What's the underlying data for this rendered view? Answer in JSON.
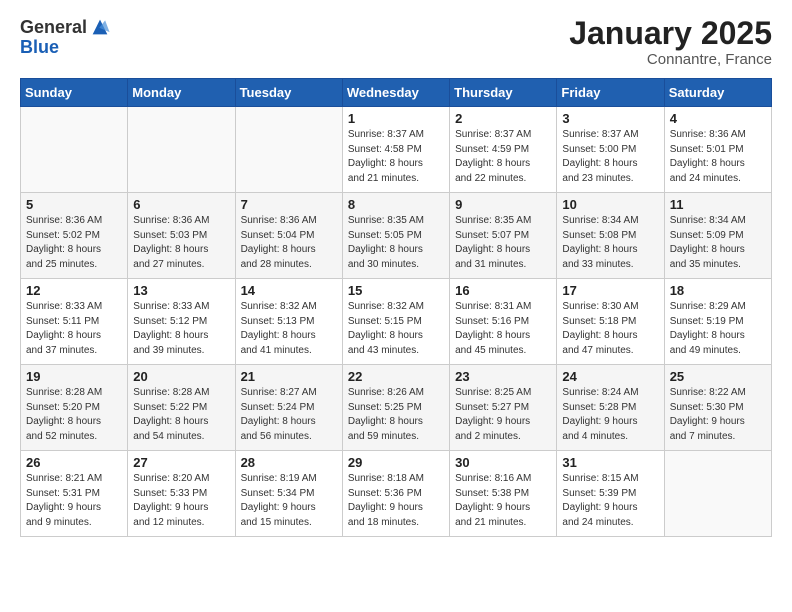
{
  "logo": {
    "general": "General",
    "blue": "Blue"
  },
  "title": "January 2025",
  "subtitle": "Connantre, France",
  "weekdays": [
    "Sunday",
    "Monday",
    "Tuesday",
    "Wednesday",
    "Thursday",
    "Friday",
    "Saturday"
  ],
  "weeks": [
    [
      {
        "day": "",
        "info": ""
      },
      {
        "day": "",
        "info": ""
      },
      {
        "day": "",
        "info": ""
      },
      {
        "day": "1",
        "info": "Sunrise: 8:37 AM\nSunset: 4:58 PM\nDaylight: 8 hours\nand 21 minutes."
      },
      {
        "day": "2",
        "info": "Sunrise: 8:37 AM\nSunset: 4:59 PM\nDaylight: 8 hours\nand 22 minutes."
      },
      {
        "day": "3",
        "info": "Sunrise: 8:37 AM\nSunset: 5:00 PM\nDaylight: 8 hours\nand 23 minutes."
      },
      {
        "day": "4",
        "info": "Sunrise: 8:36 AM\nSunset: 5:01 PM\nDaylight: 8 hours\nand 24 minutes."
      }
    ],
    [
      {
        "day": "5",
        "info": "Sunrise: 8:36 AM\nSunset: 5:02 PM\nDaylight: 8 hours\nand 25 minutes."
      },
      {
        "day": "6",
        "info": "Sunrise: 8:36 AM\nSunset: 5:03 PM\nDaylight: 8 hours\nand 27 minutes."
      },
      {
        "day": "7",
        "info": "Sunrise: 8:36 AM\nSunset: 5:04 PM\nDaylight: 8 hours\nand 28 minutes."
      },
      {
        "day": "8",
        "info": "Sunrise: 8:35 AM\nSunset: 5:05 PM\nDaylight: 8 hours\nand 30 minutes."
      },
      {
        "day": "9",
        "info": "Sunrise: 8:35 AM\nSunset: 5:07 PM\nDaylight: 8 hours\nand 31 minutes."
      },
      {
        "day": "10",
        "info": "Sunrise: 8:34 AM\nSunset: 5:08 PM\nDaylight: 8 hours\nand 33 minutes."
      },
      {
        "day": "11",
        "info": "Sunrise: 8:34 AM\nSunset: 5:09 PM\nDaylight: 8 hours\nand 35 minutes."
      }
    ],
    [
      {
        "day": "12",
        "info": "Sunrise: 8:33 AM\nSunset: 5:11 PM\nDaylight: 8 hours\nand 37 minutes."
      },
      {
        "day": "13",
        "info": "Sunrise: 8:33 AM\nSunset: 5:12 PM\nDaylight: 8 hours\nand 39 minutes."
      },
      {
        "day": "14",
        "info": "Sunrise: 8:32 AM\nSunset: 5:13 PM\nDaylight: 8 hours\nand 41 minutes."
      },
      {
        "day": "15",
        "info": "Sunrise: 8:32 AM\nSunset: 5:15 PM\nDaylight: 8 hours\nand 43 minutes."
      },
      {
        "day": "16",
        "info": "Sunrise: 8:31 AM\nSunset: 5:16 PM\nDaylight: 8 hours\nand 45 minutes."
      },
      {
        "day": "17",
        "info": "Sunrise: 8:30 AM\nSunset: 5:18 PM\nDaylight: 8 hours\nand 47 minutes."
      },
      {
        "day": "18",
        "info": "Sunrise: 8:29 AM\nSunset: 5:19 PM\nDaylight: 8 hours\nand 49 minutes."
      }
    ],
    [
      {
        "day": "19",
        "info": "Sunrise: 8:28 AM\nSunset: 5:20 PM\nDaylight: 8 hours\nand 52 minutes."
      },
      {
        "day": "20",
        "info": "Sunrise: 8:28 AM\nSunset: 5:22 PM\nDaylight: 8 hours\nand 54 minutes."
      },
      {
        "day": "21",
        "info": "Sunrise: 8:27 AM\nSunset: 5:24 PM\nDaylight: 8 hours\nand 56 minutes."
      },
      {
        "day": "22",
        "info": "Sunrise: 8:26 AM\nSunset: 5:25 PM\nDaylight: 8 hours\nand 59 minutes."
      },
      {
        "day": "23",
        "info": "Sunrise: 8:25 AM\nSunset: 5:27 PM\nDaylight: 9 hours\nand 2 minutes."
      },
      {
        "day": "24",
        "info": "Sunrise: 8:24 AM\nSunset: 5:28 PM\nDaylight: 9 hours\nand 4 minutes."
      },
      {
        "day": "25",
        "info": "Sunrise: 8:22 AM\nSunset: 5:30 PM\nDaylight: 9 hours\nand 7 minutes."
      }
    ],
    [
      {
        "day": "26",
        "info": "Sunrise: 8:21 AM\nSunset: 5:31 PM\nDaylight: 9 hours\nand 9 minutes."
      },
      {
        "day": "27",
        "info": "Sunrise: 8:20 AM\nSunset: 5:33 PM\nDaylight: 9 hours\nand 12 minutes."
      },
      {
        "day": "28",
        "info": "Sunrise: 8:19 AM\nSunset: 5:34 PM\nDaylight: 9 hours\nand 15 minutes."
      },
      {
        "day": "29",
        "info": "Sunrise: 8:18 AM\nSunset: 5:36 PM\nDaylight: 9 hours\nand 18 minutes."
      },
      {
        "day": "30",
        "info": "Sunrise: 8:16 AM\nSunset: 5:38 PM\nDaylight: 9 hours\nand 21 minutes."
      },
      {
        "day": "31",
        "info": "Sunrise: 8:15 AM\nSunset: 5:39 PM\nDaylight: 9 hours\nand 24 minutes."
      },
      {
        "day": "",
        "info": ""
      }
    ]
  ]
}
